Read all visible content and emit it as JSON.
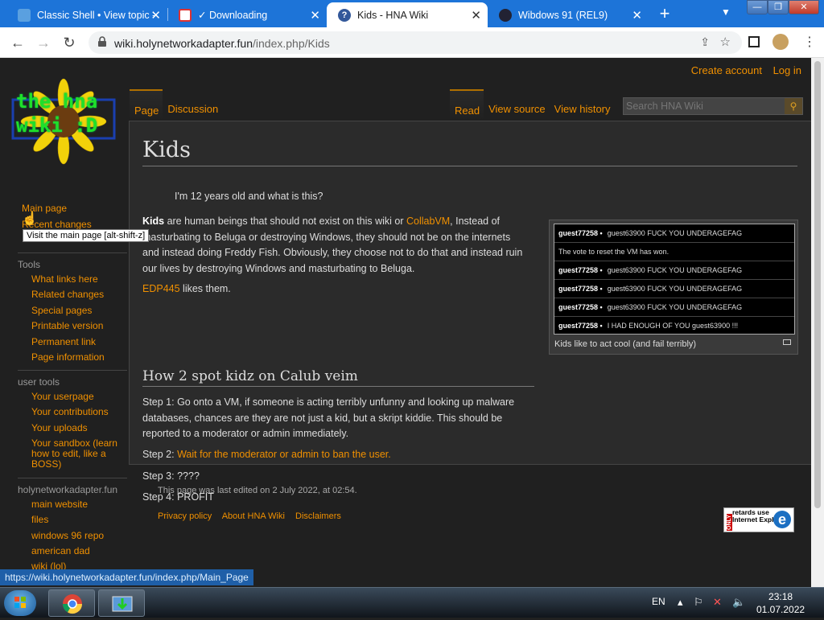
{
  "tabs": [
    {
      "title": "Classic Shell • View topic -",
      "icon": "shell-icon",
      "active": false
    },
    {
      "title": "✓ Downloading",
      "icon": "image-icon",
      "active": false
    },
    {
      "title": "Kids - HNA Wiki",
      "icon": "question-icon",
      "active": true
    },
    {
      "title": "Wibdows 91 (REL9)",
      "icon": "puzzle-icon",
      "active": false
    }
  ],
  "window_controls": [
    "—",
    "❐",
    "✕"
  ],
  "address": {
    "host": "wiki.holynetworkadapter.fun",
    "path": "/index.php/Kids"
  },
  "logo": {
    "line1": "the hna",
    "line2": "wiki :D"
  },
  "personal": {
    "create_account": "Create account",
    "login": "Log in"
  },
  "page_tabs": {
    "page": "Page",
    "discussion": "Discussion"
  },
  "view_tabs": {
    "read": "Read",
    "view_source": "View source",
    "view_history": "View history"
  },
  "search": {
    "placeholder": "Search HNA Wiki"
  },
  "content": {
    "title": "Kids",
    "intro": "I'm 12 years old and what is this?",
    "p1_bold": "Kids",
    "p1_a": " are human beings that should not exist on this wiki or ",
    "p1_link": "CollabVM",
    "p1_b": ", Instead of masturbating to Beluga or destroying Windows, they should not be on the internets and instead doing Freddy Fish. Obviously, they choose not to do that and instead ruin our lives by destroying Windows and masturbating to Beluga.",
    "p2_link": "EDP445",
    "p2_text": " likes them.",
    "h2": "How 2 spot kidz on Calub veim",
    "step1": "Step 1: Go onto a VM, if someone is acting terribly unfunny and looking up malware databases, chances are they are not just a kid, but a skript kiddie. This should be reported to a moderator or admin immediately.",
    "step2_label": "Step 2: ",
    "step2_link": "Wait for the moderator or admin to ban the user.",
    "step3": "Step 3: ????",
    "step4": "Step 4: PROFIT"
  },
  "thumbnail": {
    "caption": "Kids like to act cool (and fail terribly)",
    "chat": [
      {
        "user": "guest77258 •",
        "msg": "guest63900 FUCK YOU UNDERAGEFAG"
      },
      {
        "user": "",
        "msg": "The vote to reset the VM has won."
      },
      {
        "user": "guest77258 •",
        "msg": "guest63900 FUCK YOU UNDERAGEFAG"
      },
      {
        "user": "guest77258 •",
        "msg": "guest63900 FUCK YOU UNDERAGEFAG"
      },
      {
        "user": "guest77258 •",
        "msg": "guest63900 FUCK YOU UNDERAGEFAG"
      },
      {
        "user": "guest77258 •",
        "msg": "I HAD ENOUGH OF YOU guest63900 !!!"
      }
    ]
  },
  "sidebar": {
    "main_page": "Main page",
    "recent_changes": "Recent changes",
    "tooltip": "Visit the main page [alt-shift-z]",
    "tools_head": "Tools",
    "tools": [
      "What links here",
      "Related changes",
      "Special pages",
      "Printable version",
      "Permanent link",
      "Page information"
    ],
    "user_head": "user tools",
    "user": [
      "Your userpage",
      "Your contributions",
      "Your uploads",
      "Your sandbox (learn how to edit, like a BOSS)"
    ],
    "site_head": "holynetworkadapter.fun",
    "site": [
      "main website",
      "files",
      "windows 96 repo",
      "american dad",
      "wiki (lol)"
    ]
  },
  "footer": {
    "last_edited": "This page was last edited on 2 July 2022, at 02:54.",
    "privacy": "Privacy policy",
    "about": "About HNA Wiki",
    "disclaimers": "Disclaimers",
    "badge_side": "ONLY",
    "badge_text": "retards use Internet Explorer",
    "badge_e": "e"
  },
  "status_url": "https://wiki.holynetworkadapter.fun/index.php/Main_Page",
  "taskbar": {
    "lang": "EN",
    "time": "23:18",
    "date": "01.07.2022"
  }
}
